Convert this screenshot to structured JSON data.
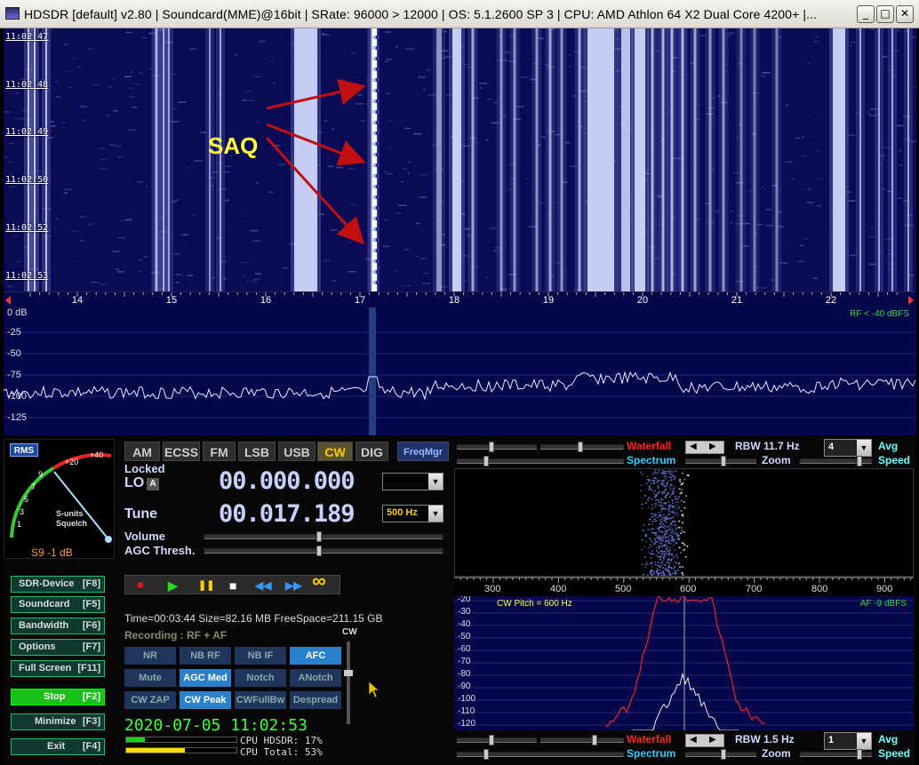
{
  "window": {
    "title": "HDSDR  [default]  v2.80   |  Soundcard(MME)@16bit   |  SRate: 96000 > 12000   |  OS: 5.1.2600 SP 3   |  CPU: AMD Athlon 64 X2 Dual Core  4200+  |...",
    "minimize": "_",
    "maximize": "□",
    "close": "✕"
  },
  "waterfall": {
    "times": [
      "11:02:47",
      "11:02:48",
      "11:02:49",
      "11:02:50",
      "11:02:52",
      "11:02:53"
    ],
    "annotation": "SAQ",
    "freq_labels": [
      "14",
      "15",
      "16",
      "17",
      "18",
      "19",
      "20",
      "21",
      "22"
    ],
    "background": "#0a0a55"
  },
  "spectrum": {
    "db_labels": [
      "0 dB",
      "-25",
      "-50",
      "-75",
      "-100",
      "-125"
    ],
    "rf_level": "RF < -40 dBFS"
  },
  "smeter": {
    "rms": "RMS",
    "scale": [
      "9",
      "7",
      "5",
      "3",
      "1",
      "+20",
      "+40"
    ],
    "label1": "S-units",
    "label2": "Squelch",
    "value": "S9 -1 dB"
  },
  "modes": [
    {
      "label": "AM",
      "active": false
    },
    {
      "label": "ECSS",
      "active": false
    },
    {
      "label": "FM",
      "active": false
    },
    {
      "label": "LSB",
      "active": false
    },
    {
      "label": "USB",
      "active": false
    },
    {
      "label": "CW",
      "active": true
    },
    {
      "label": "DIG",
      "active": false
    }
  ],
  "freqmgr": "FreqMgr",
  "lo": {
    "locked": "Locked",
    "label": "LO",
    "a": "A",
    "value": "00.000.000",
    "combo": ""
  },
  "tune": {
    "label": "Tune",
    "value": "00.017.189",
    "bandwidth": "500 Hz"
  },
  "volume_label": "Volume",
  "agc_label": "AGC Thresh.",
  "left_buttons": [
    {
      "label": "SDR-Device",
      "key": "[F8]"
    },
    {
      "label": "Soundcard",
      "key": "[F5]"
    },
    {
      "label": "Bandwidth",
      "key": "[F6]"
    },
    {
      "label": "Options",
      "key": "[F7]"
    },
    {
      "label": "Full Screen",
      "key": "[F11]"
    },
    {
      "label": "Stop",
      "key": "[F2]"
    },
    {
      "label": "Minimize",
      "key": "[F3]"
    },
    {
      "label": "Exit",
      "key": "[F4]"
    }
  ],
  "transport": {
    "record": "●",
    "play": "▶",
    "pause": "❚❚",
    "stop": "■",
    "rewind": "◀◀",
    "forward": "▶▶",
    "loop": "∞"
  },
  "status": {
    "line": "Time=00:03:44  Size=82.16 MB  FreeSpace=211.15 GB",
    "recording": "Recording : RF + AF",
    "cw": "CW"
  },
  "dsp_buttons": [
    {
      "label": "NR",
      "on": false
    },
    {
      "label": "NB RF",
      "on": false
    },
    {
      "label": "NB IF",
      "on": false
    },
    {
      "label": "AFC",
      "on": true
    },
    {
      "label": "Mute",
      "on": false
    },
    {
      "label": "AGC Med",
      "on": true
    },
    {
      "label": "Notch",
      "on": false
    },
    {
      "label": "ANotch",
      "on": false
    },
    {
      "label": "CW ZAP",
      "on": false
    },
    {
      "label": "CW Peak",
      "on": true
    },
    {
      "label": "CWFullBw",
      "on": false
    },
    {
      "label": "Despread",
      "on": false
    }
  ],
  "clock": "2020-07-05 11:02:53",
  "cpu": {
    "hdsdr_label": "CPU HDSDR:  17%",
    "total_label": "CPU Total:  53%",
    "hdsdr_fraction": 0.17,
    "total_fraction": 0.53
  },
  "rf_controls": {
    "waterfall": "Waterfall",
    "spectrum": "Spectrum",
    "rbw": "RBW 11.7 Hz",
    "zoom": "Zoom",
    "avg_value": "4",
    "avg": "Avg",
    "speed": "Speed",
    "left_arrow": "◀",
    "right_arrow": "▶"
  },
  "af_controls": {
    "waterfall": "Waterfall",
    "spectrum": "Spectrum",
    "rbw": "RBW  1.5 Hz",
    "zoom": "Zoom",
    "avg_value": "1",
    "avg": "Avg",
    "speed": "Speed",
    "left_arrow": "◀",
    "right_arrow": "▶"
  },
  "audio_scale": [
    "300",
    "400",
    "500",
    "600",
    "700",
    "800",
    "900"
  ],
  "audio_spectrum": {
    "db_labels": [
      "-20",
      "-30",
      "-40",
      "-50",
      "-60",
      "-70",
      "-80",
      "-90",
      "-100",
      "-110",
      "-120"
    ],
    "cw_pitch": "CW Pitch = 600 Hz",
    "af_level": "AF  -9 dBFS"
  }
}
